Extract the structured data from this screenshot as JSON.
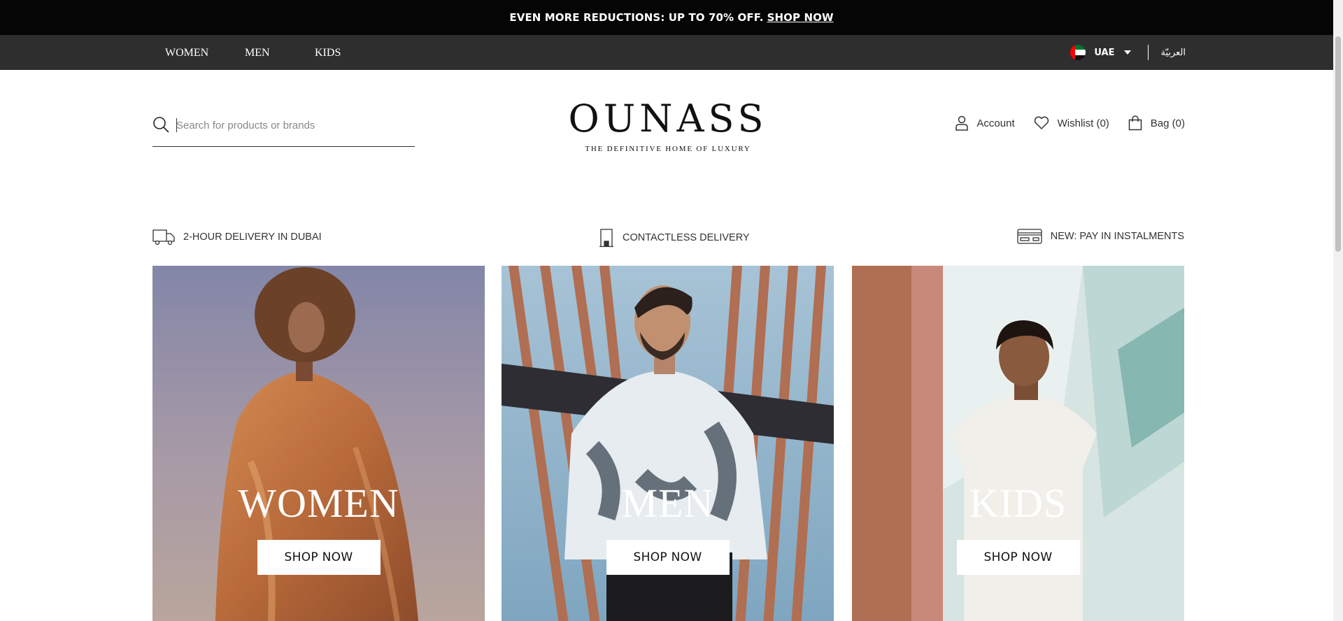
{
  "promo": {
    "text": "EVEN MORE REDUCTIONS: UP TO 70% OFF.",
    "link": "SHOP NOW"
  },
  "nav": {
    "departments": [
      "WOMEN",
      "MEN",
      "KIDS"
    ],
    "country": "UAE",
    "language": "العربيّة"
  },
  "search": {
    "placeholder": "Search for products or brands"
  },
  "brand": {
    "logo": "OUNASS",
    "tagline": "THE DEFINITIVE HOME OF LUXURY"
  },
  "utilities": {
    "account": "Account",
    "wishlist": "Wishlist (0)",
    "bag": "Bag (0)"
  },
  "features": [
    "2-HOUR DELIVERY IN DUBAI",
    "CONTACTLESS DELIVERY",
    "NEW: PAY IN INSTALMENTS"
  ],
  "cards": [
    {
      "title": "WOMEN",
      "cta": "SHOP NOW"
    },
    {
      "title": "MEN",
      "cta": "SHOP NOW"
    },
    {
      "title": "KIDS",
      "cta": "SHOP NOW"
    }
  ],
  "icons": [
    "search-icon",
    "user-icon",
    "heart-icon",
    "bag-icon",
    "delivery-truck-icon",
    "door-icon",
    "card-icon",
    "uae-flag-icon",
    "caret-down-icon"
  ],
  "colors": {
    "promo_bg": "#050505",
    "nav_bg": "#2e2e2e",
    "text": "#222222",
    "cta_bg": "#ffffff"
  }
}
